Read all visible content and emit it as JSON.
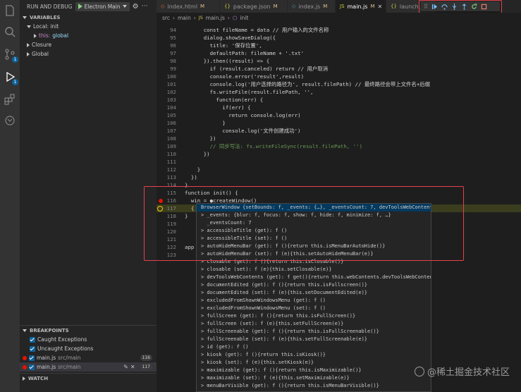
{
  "sidebar": {
    "run_header": "RUN AND DEBUG",
    "config": "Electron Main",
    "variables": {
      "title": "VARIABLES",
      "local": "Local: init",
      "this_label": "this:",
      "this_value": "global",
      "closure": "Closure",
      "global": "Global"
    },
    "breakpoints": {
      "title": "BREAKPOINTS",
      "caught": "Caught Exceptions",
      "uncaught": "Uncaught Exceptions",
      "items": [
        {
          "file": "main.js",
          "path": "src/main",
          "line": "116"
        },
        {
          "file": "main.js",
          "path": "src/main",
          "line": "117"
        }
      ]
    },
    "watch": "WATCH"
  },
  "tabs": [
    {
      "label": "index.html",
      "mod": "M"
    },
    {
      "label": "package.json",
      "mod": "M"
    },
    {
      "label": "index.js",
      "mod": "M"
    },
    {
      "label": "main.js",
      "mod": "M"
    },
    {
      "label": "launch.j",
      "mod": ""
    }
  ],
  "breadcrumb": {
    "a": "src",
    "b": "main",
    "c": "main.js",
    "d": "init"
  },
  "colors": {
    "breakpoint": "#e51400",
    "accent": "#0e639c",
    "annotation": "#e8404c"
  },
  "code_lines": [
    {
      "n": "94",
      "t": "      const fileName = data // 用户输入的文件名称"
    },
    {
      "n": "95",
      "t": "      dialog.showSaveDialog({"
    },
    {
      "n": "96",
      "t": "        title: '保存位置',"
    },
    {
      "n": "97",
      "t": "        defaultPath: fileName + '.txt'"
    },
    {
      "n": "98",
      "t": "      }).then((result) => {"
    },
    {
      "n": "99",
      "t": "        if (result.canceled) return // 用户取消"
    },
    {
      "n": "100",
      "t": "        console.error('result',result)"
    },
    {
      "n": "101",
      "t": "        console.log('用户选择的路径为', result.filePath) // 最终路径会带上文件名+后缀"
    },
    {
      "n": "102",
      "t": "        fs.writeFile(result.filePath, '',"
    },
    {
      "n": "103",
      "t": "          function(err) {"
    },
    {
      "n": "104",
      "t": "            if(err) {"
    },
    {
      "n": "105",
      "t": "              return console.log(err)"
    },
    {
      "n": "106",
      "t": "            }"
    },
    {
      "n": "107",
      "t": "            console.log('文件创建成功')"
    },
    {
      "n": "108",
      "t": "        })"
    },
    {
      "n": "109",
      "t": "        // 同步写法: fs.writeFileSync(result.filePath, '')"
    },
    {
      "n": "110",
      "t": "      })"
    },
    {
      "n": "111",
      "t": ""
    },
    {
      "n": "112",
      "t": "    }"
    },
    {
      "n": "113",
      "t": "  })"
    },
    {
      "n": "114",
      "t": "}"
    },
    {
      "n": "115",
      "t": "function init() {"
    },
    {
      "n": "116",
      "t": "  win = ●createWindow()"
    },
    {
      "n": "117",
      "t": "  {"
    },
    {
      "n": "118",
      "t": "}"
    },
    {
      "n": "119",
      "t": ""
    },
    {
      "n": "120",
      "t": ""
    },
    {
      "n": "121",
      "t": ""
    },
    {
      "n": "122",
      "t": "app"
    },
    {
      "n": "123",
      "t": ""
    }
  ],
  "hover_lines": [
    "BrowserWindow {setBounds: f, _events: {…}, _eventsCount: 7, devToolsWebContents…",
    "> _events: {blur: f, focus: f, show: f, hide: f, minimize: f, …}",
    "  _eventsCount: 7",
    "> accessibleTitle (get): f ()",
    "> accessibleTitle (set): f ()",
    "> autoHideMenuBar (get): f (){return this.isMenuBarAutoHide()}",
    "> autoHideMenuBar (set): f (e){this.setAutoHideMenuBar(e)}",
    "> closable (get): f (){return this.isClosable()}",
    "> closable (set): f (e){this.setClosable(e)}",
    "> devToolsWebContents (get): f get(){return this.webContents.devToolsWebContent…",
    "> documentEdited (get): f (){return this.isFullscreen()}",
    "> documentEdited (set): f (e){this.setDocumentEdited(e)}",
    "> excludedFromShownWindowsMenu (get): f ()",
    "> excludedFromShownWindowsMenu (set): f ()",
    "> fullScreen (get): f (){return this.isFullScreen()}",
    "> fullScreen (set): f (e){this.setFullScreen(e)}",
    "> fullScreenable (get): f (){return this.isFullScreenable()}",
    "> fullScreenable (set): f (e){this.setFullScreenable(e)}",
    "> id (get): f ()",
    "> kiosk (get): f (){return this.isKiosk()}",
    "> kiosk (set): f (e){this.setKiosk(e)}",
    "> maximizable (get): f (){return this.isMaximizable()}",
    "> maximizable (set): f (e){this.setMaximizable(e)}",
    "> menuBarVisible (get): f (){return this.isMenuBarVisible()}"
  ],
  "watermark": "@稀土掘金技术社区"
}
